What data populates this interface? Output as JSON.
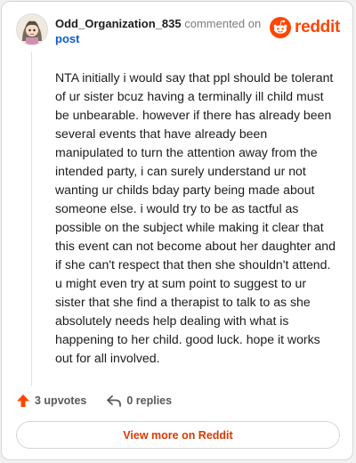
{
  "comment": {
    "author": "Odd_Organization_835",
    "action": "commented on",
    "target_link": "post",
    "body": "NTA initially i would say that ppl should be tolerant of ur sister bcuz having a terminally ill child must be unbearable. however if there has already been several events that have already been manipulated to turn the attention away from the intended party, i can surely understand ur not wanting ur childs bday party being made about someone else. i would try to be as tactful as possible on the subject while making it clear that this event can not become about her daughter and if she can't respect that then she shouldn't attend. u might even try at sum point to suggest to ur sister that she find a therapist to talk to as she absolutely needs help dealing with what is happening to her child. good luck. hope it works out for all involved.",
    "upvotes": "3 upvotes",
    "replies": "0 replies"
  },
  "brand": {
    "name": "reddit",
    "color": "#ff4500"
  },
  "view_more_label": "View more on Reddit",
  "icons": {
    "upvote": "upvote-arrow-icon",
    "reply": "reply-arrow-icon",
    "logo": "reddit-snoo-icon"
  }
}
